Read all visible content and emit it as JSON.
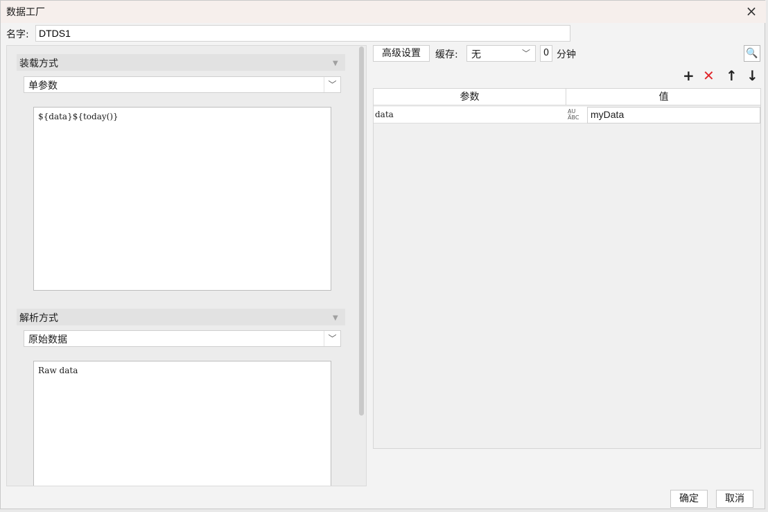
{
  "window": {
    "title": "数据工厂",
    "close_icon": "×"
  },
  "name_row": {
    "label": "名字:",
    "value": "DTDS1"
  },
  "load_section": {
    "header": "装载方式",
    "selected": "单参数",
    "content": "${data}${today()}"
  },
  "parse_section": {
    "header": "解析方式",
    "selected": "原始数据",
    "content": "Raw data"
  },
  "toolbar": {
    "advanced_label": "高级设置",
    "cache_label": "缓存:",
    "cache_value": "无",
    "minutes_value": "0",
    "minutes_unit": "分钟",
    "add_icon": "+",
    "delete_icon": "✕",
    "up_icon": "↑",
    "down_icon": "↓"
  },
  "params_table": {
    "columns": [
      "参数",
      "值"
    ],
    "rows": [
      {
        "param": "data",
        "type_icon": "abc-type-icon",
        "value": "myData"
      }
    ]
  },
  "footer": {
    "ok_label": "确定",
    "cancel_label": "取消"
  },
  "colors": {
    "delete": "#e0262b",
    "titlebar": "#f6efec"
  }
}
